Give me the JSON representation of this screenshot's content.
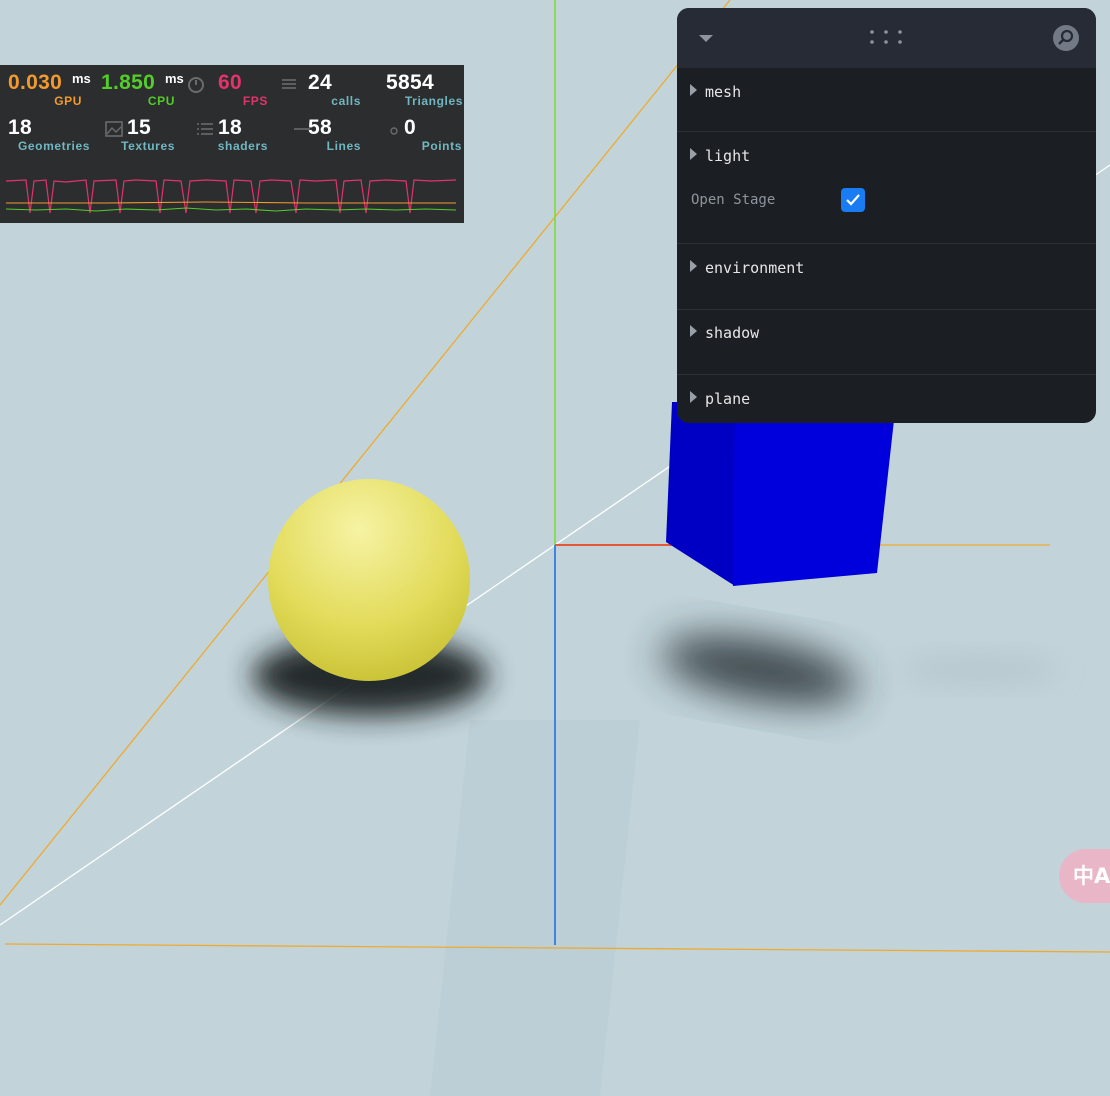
{
  "stats": {
    "gpu": {
      "value": "0.030",
      "unit": "ms",
      "label": "GPU",
      "color": "#f29a2e"
    },
    "cpu": {
      "value": "1.850",
      "unit": "ms",
      "label": "CPU",
      "color": "#54cc2b"
    },
    "fps": {
      "value": "60",
      "label": "FPS",
      "color": "#e3336b"
    },
    "calls": {
      "value": "24",
      "label": "calls"
    },
    "triangles": {
      "value": "5854",
      "label": "Triangles"
    },
    "geometries": {
      "value": "18",
      "label": "Geometries"
    },
    "textures": {
      "value": "15",
      "label": "Textures"
    },
    "shaders": {
      "value": "18",
      "label": "shaders"
    },
    "lines": {
      "value": "58",
      "label": "Lines"
    },
    "points": {
      "value": "0",
      "label": "Points"
    }
  },
  "gui": {
    "folders": [
      {
        "label": "mesh"
      },
      {
        "label": "light",
        "controls": [
          {
            "label": "Open Stage",
            "checked": true
          }
        ]
      },
      {
        "label": "environment"
      },
      {
        "label": "shadow"
      },
      {
        "label": "plane"
      }
    ]
  },
  "translate_button": {
    "label": "中A"
  },
  "scene": {
    "background": "#c2d4da",
    "sphere_color": "#e8e27a",
    "cube_color": "#0000dd",
    "axis_colors": {
      "x": "#e8462a",
      "y": "#7ddc3a",
      "z": "#2f7be0"
    }
  }
}
